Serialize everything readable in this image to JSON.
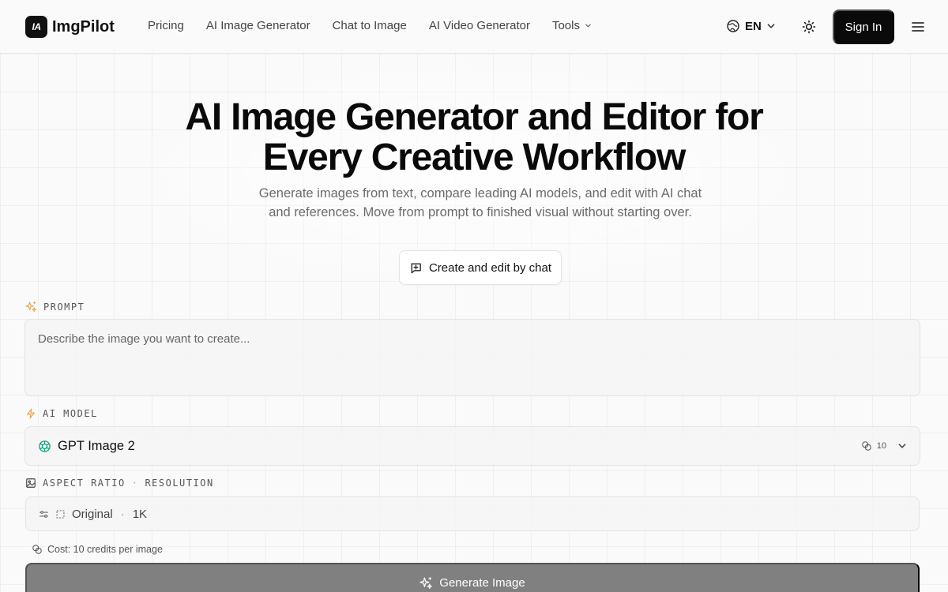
{
  "brand": {
    "logo_mark": "IA",
    "name": "ImgPilot"
  },
  "nav": {
    "items": [
      "Pricing",
      "AI Image Generator",
      "Chat to Image",
      "AI Video Generator"
    ],
    "tools_label": "Tools"
  },
  "header": {
    "language": "EN",
    "sign_in": "Sign In"
  },
  "hero": {
    "title_line1": "AI Image Generator and Editor for",
    "title_line2": "Every Creative Workflow",
    "subtitle": "Generate images from text, compare leading AI models, and edit with AI chat and references. Move from prompt to finished visual without starting over.",
    "chat_button": "Create and edit by chat"
  },
  "form": {
    "prompt_label": "PROMPT",
    "prompt_placeholder": "Describe the image you want to create...",
    "model_label": "AI MODEL",
    "model_name": "GPT Image 2",
    "model_credits": "10",
    "ratio_label": "ASPECT RATIO",
    "resolution_label": "RESOLUTION",
    "ratio_value": "Original",
    "resolution_value": "1K",
    "cost_text": "Cost: 10 credits per image",
    "generate_button": "Generate Image"
  },
  "colors": {
    "primary_dark": "#0a0a0a",
    "accent_orange": "#e8a050",
    "model_green": "#10a37f",
    "generate_disabled": "#808080"
  },
  "icons": [
    "globe-icon",
    "chevron-down-icon",
    "sun-icon",
    "menu-icon",
    "chat-plus-icon",
    "sparkle-icon",
    "lightning-icon",
    "image-icon",
    "openai-icon",
    "coins-icon",
    "sliders-icon",
    "crop-icon"
  ]
}
